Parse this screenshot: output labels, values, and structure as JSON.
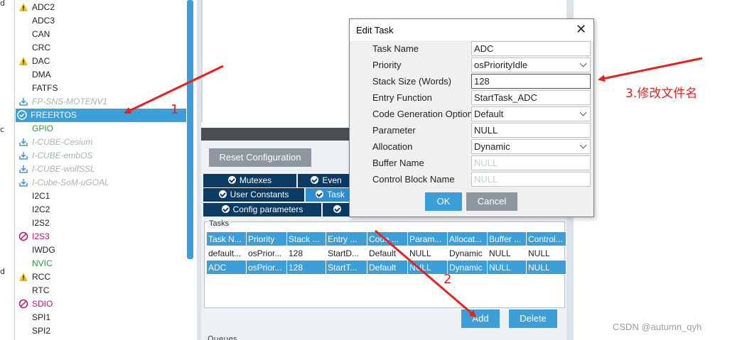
{
  "sidebar": {
    "strip_letters": [
      "d",
      "c",
      "d"
    ],
    "items": [
      {
        "label": "ADC2",
        "icon": "warning-icon",
        "style": "normal"
      },
      {
        "label": "ADC3",
        "icon": "",
        "style": "normal"
      },
      {
        "label": "CAN",
        "icon": "",
        "style": "normal"
      },
      {
        "label": "CRC",
        "icon": "",
        "style": "normal"
      },
      {
        "label": "DAC",
        "icon": "warning-icon",
        "style": "normal"
      },
      {
        "label": "DMA",
        "icon": "",
        "style": "normal"
      },
      {
        "label": "FATFS",
        "icon": "",
        "style": "normal"
      },
      {
        "label": "FP-SNS-MOTENV1",
        "icon": "download-icon",
        "style": "gray"
      },
      {
        "label": "FREERTOS",
        "icon": "check-circle-icon",
        "style": "selected"
      },
      {
        "label": "GPIO",
        "icon": "",
        "style": "green"
      },
      {
        "label": "I-CUBE-Cesium",
        "icon": "download-icon",
        "style": "gray"
      },
      {
        "label": "I-CUBE-embOS",
        "icon": "download-icon",
        "style": "gray"
      },
      {
        "label": "I-CUBE-wolfSSL",
        "icon": "download-icon",
        "style": "gray"
      },
      {
        "label": "I-Cube-SoM-uGOAL",
        "icon": "download-icon",
        "style": "gray"
      },
      {
        "label": "I2C1",
        "icon": "",
        "style": "normal"
      },
      {
        "label": "I2C2",
        "icon": "",
        "style": "normal"
      },
      {
        "label": "I2S2",
        "icon": "",
        "style": "normal"
      },
      {
        "label": "I2S3",
        "icon": "forbidden-icon",
        "style": "magenta"
      },
      {
        "label": "IWDG",
        "icon": "",
        "style": "normal"
      },
      {
        "label": "NVIC",
        "icon": "",
        "style": "green"
      },
      {
        "label": "RCC",
        "icon": "warning-icon",
        "style": "normal"
      },
      {
        "label": "RTC",
        "icon": "",
        "style": "normal"
      },
      {
        "label": "SDIO",
        "icon": "forbidden-icon",
        "style": "magenta"
      },
      {
        "label": "SPI1",
        "icon": "",
        "style": "normal"
      },
      {
        "label": "SPI2",
        "icon": "",
        "style": "normal"
      }
    ]
  },
  "config": {
    "reset_label": "Reset Configuration",
    "tabs": {
      "mutexes": "Mutexes",
      "events": "Even",
      "user_constants": "User Constants",
      "tasks": "Task",
      "config_parameters": "Config parameters"
    },
    "tasks_legend": "Tasks",
    "columns": [
      "Task N...",
      "Priority",
      "Stack ...",
      "Entry ...",
      "Code ...",
      "Param...",
      "Allocat...",
      "Buffer ...",
      "Control..."
    ],
    "rows": [
      [
        "default...",
        "osPrior...",
        "128",
        "StartD...",
        "Default",
        "NULL",
        "Dynamic",
        "NULL",
        "NULL"
      ],
      [
        "ADC",
        "osPrior...",
        "128",
        "StartT...",
        "Default",
        "NULL",
        "Dynamic",
        "NULL",
        "NULL"
      ]
    ],
    "add_label": "Add",
    "delete_label": "Delete",
    "queues_label": "Queues"
  },
  "dialog": {
    "title": "Edit Task",
    "close_glyph": "✕",
    "fields": [
      {
        "label": "Task Name",
        "value": "ADC",
        "kind": "text"
      },
      {
        "label": "Priority",
        "value": "osPriorityIdle",
        "kind": "select"
      },
      {
        "label": "Stack Size (Words)",
        "value": "128",
        "kind": "focused"
      },
      {
        "label": "Entry Function",
        "value": "StartTask_ADC",
        "kind": "text"
      },
      {
        "label": "Code Generation Option",
        "value": "Default",
        "kind": "select"
      },
      {
        "label": "Parameter",
        "value": "NULL",
        "kind": "text"
      },
      {
        "label": "Allocation",
        "value": "Dynamic",
        "kind": "select"
      },
      {
        "label": "Buffer Name",
        "value": "NULL",
        "kind": "disabled"
      },
      {
        "label": "Control Block Name",
        "value": "NULL",
        "kind": "disabled"
      }
    ],
    "ok_label": "OK",
    "cancel_label": "Cancel"
  },
  "annotations": {
    "step1": "1",
    "step2": "2",
    "step3": "3.修改文件名"
  },
  "watermark": "CSDN @autumn_qyh",
  "colors": {
    "accent": "#3c9fd8",
    "tab_dark": "#0b3a63",
    "annotation_red": "#e8211d",
    "warning": "#f2c200",
    "forbidden": "#c0117d"
  }
}
